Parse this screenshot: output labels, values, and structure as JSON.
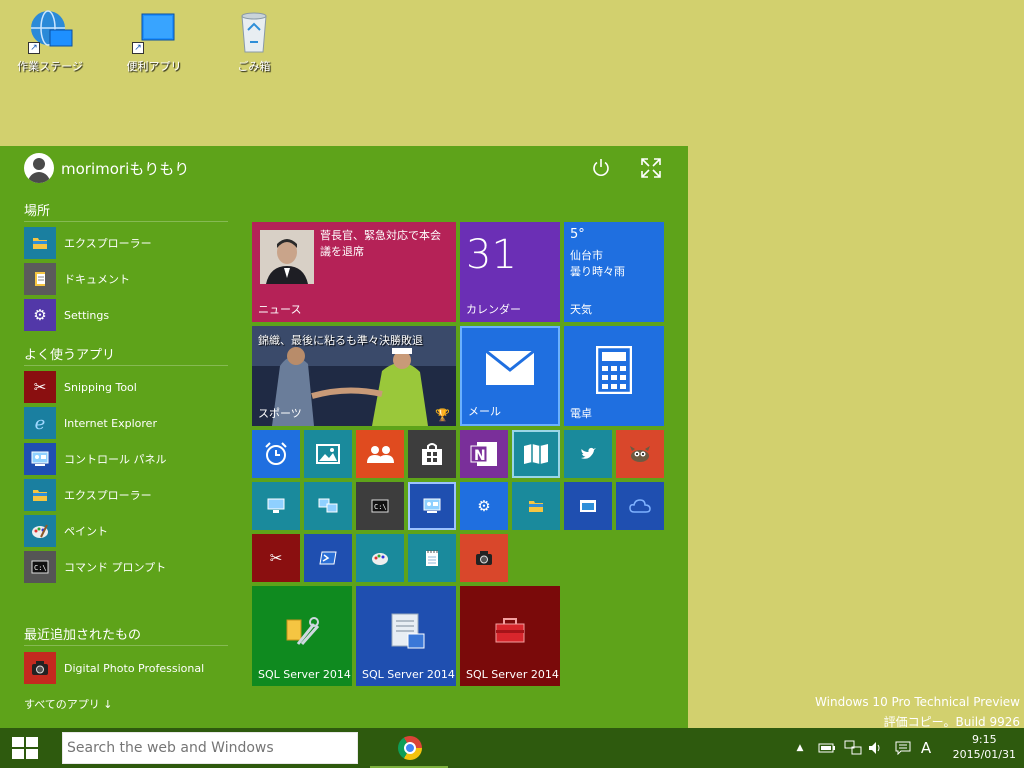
{
  "desktop": {
    "icons": [
      {
        "label": "作業ステージ",
        "icon": "globe-network-icon"
      },
      {
        "label": "便利アプリ",
        "icon": "monitor-icon"
      },
      {
        "label": "ごみ箱",
        "icon": "recycle-bin-icon"
      }
    ]
  },
  "start_menu": {
    "user_name": "morimoriもりもり",
    "places_title": "場所",
    "places": [
      {
        "label": "エクスプローラー",
        "icon": "folder-icon"
      },
      {
        "label": "ドキュメント",
        "icon": "documents-icon"
      },
      {
        "label": "Settings",
        "icon": "gear-icon"
      }
    ],
    "frequent_title": "よく使うアプリ",
    "frequent": [
      {
        "label": "Snipping Tool",
        "icon": "scissors-icon"
      },
      {
        "label": "Internet Explorer",
        "icon": "internet-explorer-icon"
      },
      {
        "label": "コントロール パネル",
        "icon": "control-panel-icon"
      },
      {
        "label": "エクスプローラー",
        "icon": "folder-icon"
      },
      {
        "label": "ペイント",
        "icon": "paint-palette-icon"
      },
      {
        "label": "コマンド プロンプト",
        "icon": "command-prompt-icon"
      }
    ],
    "recent_title": "最近追加されたもの",
    "recent": [
      {
        "label": "Digital Photo Professional",
        "icon": "camera-icon"
      }
    ],
    "all_apps": "すべてのアプリ ↓"
  },
  "tiles": {
    "news": {
      "headline": "菅長官、緊急対応で本会議を退席",
      "label": "ニュース"
    },
    "calendar": {
      "day": "31",
      "label": "カレンダー"
    },
    "weather": {
      "temp": "5°",
      "city": "仙台市",
      "condition": "曇り時々雨",
      "label": "天気"
    },
    "sports": {
      "headline": "錦織、最後に粘るも準々決勝敗退",
      "label": "スポーツ"
    },
    "mail": {
      "label": "メール"
    },
    "calculator": {
      "label": "電卓"
    },
    "sql1": {
      "label": "SQL Server 2014"
    },
    "sql2": {
      "label": "SQL Server 2014"
    },
    "sql3": {
      "label": "SQL Server 2014"
    }
  },
  "watermark": {
    "line1": "Windows 10 Pro Technical Preview",
    "line2": "評価コピー。Build 9926"
  },
  "taskbar": {
    "search_placeholder": "Search the web and Windows",
    "ime": "A",
    "time": "9:15",
    "date": "2015/01/31"
  },
  "colors": {
    "desktop": "#d2d06e",
    "start_bg": "#5ea31a",
    "taskbar": "#2e5a0e",
    "tile_blue": "#1f6fe0",
    "tile_purple": "#6b2fb5",
    "tile_red": "#b32156",
    "tile_teal": "#1a8a9c"
  }
}
